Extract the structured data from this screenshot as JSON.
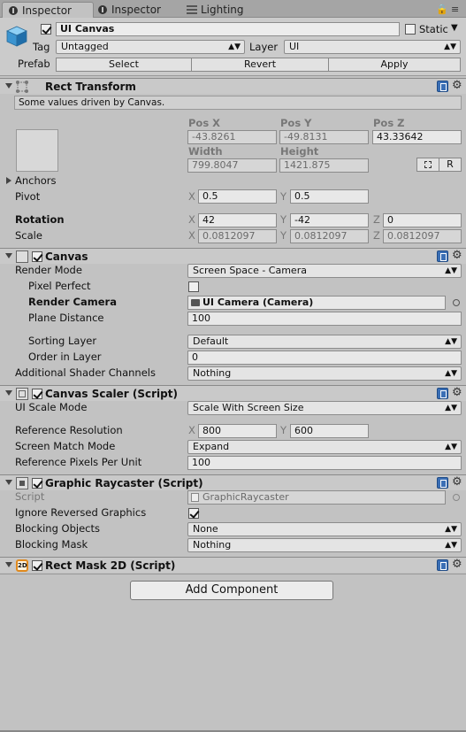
{
  "tabs": [
    {
      "label": "Inspector",
      "active": true
    },
    {
      "label": "Inspector",
      "active": false
    },
    {
      "label": "Lighting",
      "active": false
    }
  ],
  "tab_controls": {
    "lock": "🔒",
    "menu": "≡"
  },
  "header": {
    "object_name": "UI Canvas",
    "active_checked": true,
    "static_label": "Static",
    "tag_label": "Tag",
    "tag_value": "Untagged",
    "layer_label": "Layer",
    "layer_value": "UI",
    "prefab_label": "Prefab",
    "select": "Select",
    "revert": "Revert",
    "apply": "Apply"
  },
  "rect_transform": {
    "title": "Rect Transform",
    "note": "Some values driven by Canvas.",
    "pos_x_label": "Pos X",
    "pos_y_label": "Pos Y",
    "pos_z_label": "Pos Z",
    "pos_x": "-43.8261",
    "pos_y": "-49.8131",
    "pos_z": "43.33642",
    "width_label": "Width",
    "height_label": "Height",
    "width": "799.8047",
    "height": "1421.875",
    "raw_btn": "R",
    "anchors_label": "Anchors",
    "pivot_label": "Pivot",
    "pivot_x": "0.5",
    "pivot_y": "0.5",
    "rotation_label": "Rotation",
    "rot_x": "42",
    "rot_y": "-42",
    "rot_z": "0",
    "scale_label": "Scale",
    "scale_x": "0.0812097",
    "scale_y": "0.0812097",
    "scale_z": "0.0812097",
    "x": "X",
    "y": "Y",
    "z": "Z"
  },
  "canvas": {
    "title": "Canvas",
    "render_mode_label": "Render Mode",
    "render_mode": "Screen Space - Camera",
    "pixel_perfect_label": "Pixel Perfect",
    "render_camera_label": "Render Camera",
    "render_camera": "UI Camera (Camera)",
    "plane_distance_label": "Plane Distance",
    "plane_distance": "100",
    "sorting_layer_label": "Sorting Layer",
    "sorting_layer": "Default",
    "order_in_layer_label": "Order in Layer",
    "order_in_layer": "0",
    "shader_channels_label": "Additional Shader Channels",
    "shader_channels": "Nothing"
  },
  "canvas_scaler": {
    "title": "Canvas Scaler (Script)",
    "ui_scale_mode_label": "UI Scale Mode",
    "ui_scale_mode": "Scale With Screen Size",
    "ref_res_label": "Reference Resolution",
    "ref_x": "800",
    "ref_y": "600",
    "match_mode_label": "Screen Match Mode",
    "match_mode": "Expand",
    "ref_ppu_label": "Reference Pixels Per Unit",
    "ref_ppu": "100"
  },
  "graphic_raycaster": {
    "title": "Graphic Raycaster (Script)",
    "script_label": "Script",
    "script": "GraphicRaycaster",
    "ignore_reversed_label": "Ignore Reversed Graphics",
    "blocking_objects_label": "Blocking Objects",
    "blocking_objects": "None",
    "blocking_mask_label": "Blocking Mask",
    "blocking_mask": "Nothing"
  },
  "rect_mask": {
    "title": "Rect Mask 2D (Script)",
    "badge": "2D"
  },
  "add_component": "Add Component"
}
